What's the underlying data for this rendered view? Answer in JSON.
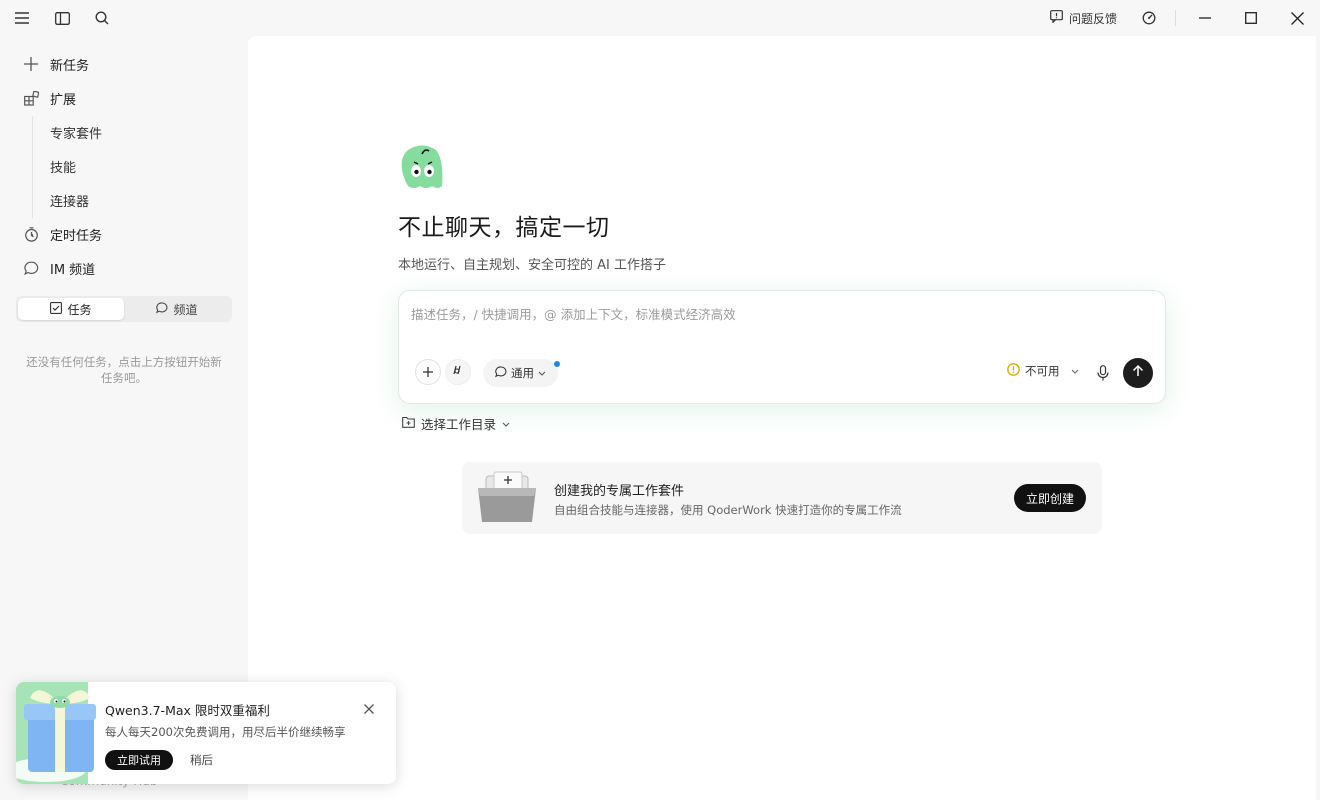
{
  "titlebar": {
    "feedback_label": "问题反馈",
    "icons": [
      "menu-icon",
      "sidebar-toggle-icon",
      "search-icon",
      "feedback-icon",
      "dashboard-icon",
      "minimize-icon",
      "maximize-icon",
      "close-icon"
    ]
  },
  "sidebar": {
    "new_task": "新任务",
    "extensions": "扩展",
    "sub_items": [
      "专家套件",
      "技能",
      "连接器"
    ],
    "scheduled": "定时任务",
    "im_channel": "IM 频道",
    "segments": {
      "tasks": "任务",
      "channels": "频道",
      "active": "tasks"
    },
    "empty_hint": "还没有任何任务，点击上方按钮开始新任务吧。",
    "community": "Community Hub"
  },
  "main": {
    "headline": "不止聊天，搞定一切",
    "subline": "本地运行、自主规划、安全可控的 AI 工作搭子",
    "composer": {
      "placeholder": "描述任务，/ 快捷调用，@ 添加上下文，标准模式经济高效",
      "mode_label": "通用",
      "model_label": "不可用"
    },
    "dir_selector": "选择工作目录",
    "suite_card": {
      "title": "创建我的专属工作套件",
      "desc": "自由组合技能与连接器，使用 QoderWork 快速打造你的专属工作流",
      "button": "立即创建"
    }
  },
  "toast": {
    "title": "Qwen3.7-Max 限时双重福利",
    "desc": "每人每天200次免费调用，用尽后半价继续畅享",
    "try_label": "立即试用",
    "later_label": "稍后"
  },
  "colors": {
    "accent_green": "#7fd89a",
    "send_button": "#1d1d1d",
    "status_dot": "#1e88e5",
    "warning": "#e0a800"
  }
}
